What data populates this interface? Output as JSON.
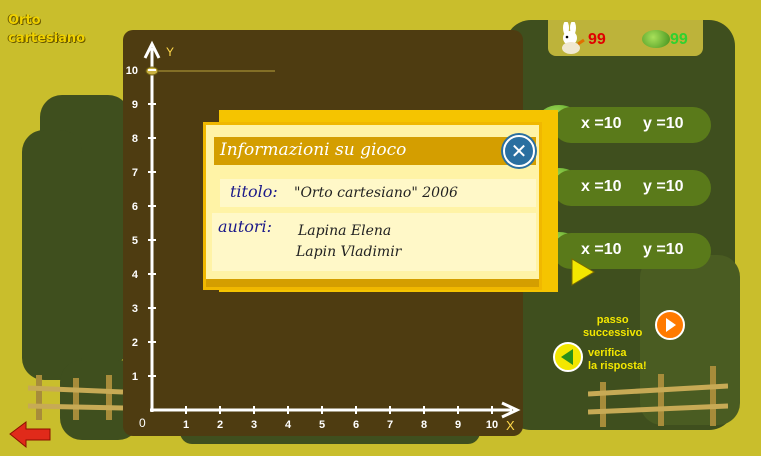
{
  "game": {
    "title": "Orto\ncartesiano"
  },
  "graph": {
    "y_axis_label": "Y",
    "x_axis_label": "X",
    "origin_label": "0",
    "x_ticks": [
      "1",
      "2",
      "3",
      "4",
      "5",
      "6",
      "7",
      "8",
      "9",
      "10"
    ],
    "y_ticks": [
      "1",
      "2",
      "3",
      "4",
      "5",
      "6",
      "7",
      "8",
      "9",
      "10"
    ]
  },
  "scores": {
    "rabbit": "99",
    "lettuce": "99",
    "rabbit_color": "#e00000",
    "lettuce_color": "#2fd12f"
  },
  "coordinates": [
    {
      "x_label": "x =10",
      "y_label": "y =10"
    },
    {
      "x_label": "x =10",
      "y_label": "y =10"
    },
    {
      "x_label": "x =10",
      "y_label": "y =10"
    }
  ],
  "controls": {
    "next_label": "passo\nsuccessivo",
    "verify_label": "verifica\nla risposta!"
  },
  "dialog": {
    "title": "Informazioni su gioco",
    "title_label": "titolo:",
    "title_value": "\"Orto cartesiano\" 2006",
    "authors_label": "autori:",
    "author1": "Lapina Elena",
    "author2": "Lapin Vladimir"
  },
  "icons": [
    "rabbit-icon",
    "lettuce-icon",
    "close-icon",
    "next-arrow-icon",
    "verify-arrow-icon",
    "back-arrow-icon"
  ]
}
